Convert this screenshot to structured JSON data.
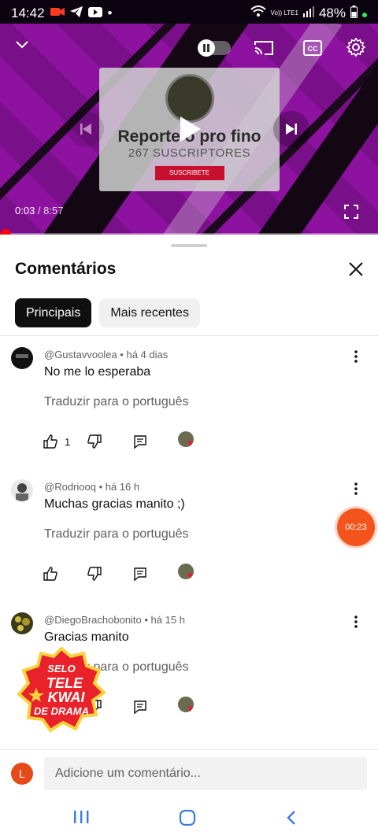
{
  "status_bar": {
    "time": "14:42",
    "battery": "48%",
    "network": "Vo)) LTE1"
  },
  "video": {
    "current_time": "0:03",
    "separator": " / ",
    "duration": "8:57",
    "card": {
      "channel_name": "Reporte o pro fino",
      "subscribers": "267 SUSCRIPTORES",
      "subscribe_label": "SUSCRIBETE"
    },
    "progress_fraction": 0.006
  },
  "comments_panel": {
    "title": "Comentários",
    "tabs": [
      {
        "label": "Principais",
        "active": true
      },
      {
        "label": "Mais recentes",
        "active": false
      }
    ]
  },
  "comments": [
    {
      "meta": "@Gustavvoolea • há 4 dias",
      "text": "No me lo esperaba",
      "translate": "Traduzir para o português",
      "likes": "1"
    },
    {
      "meta": "@Rodriooq • há 16 h",
      "text": "Muchas gracias  manito ;)",
      "translate": "Traduzir para o português",
      "likes": ""
    },
    {
      "meta": "@DiegoBrachobonito • há 15 h",
      "text": "Gracias manito",
      "translate": "Traduzir para o português",
      "likes": ""
    }
  ],
  "timer_badge": "00:23",
  "overlay_logo": {
    "line1": "SELO",
    "line2": "TELE",
    "line3": "KWAI",
    "line4": "DE DRAMA"
  },
  "comment_box": {
    "avatar_letter": "L",
    "placeholder": "Adicione um comentário..."
  },
  "colors": {
    "accent_red": "#ff0000",
    "timer_orange": "#f2541b",
    "heart": "#e8173e"
  }
}
